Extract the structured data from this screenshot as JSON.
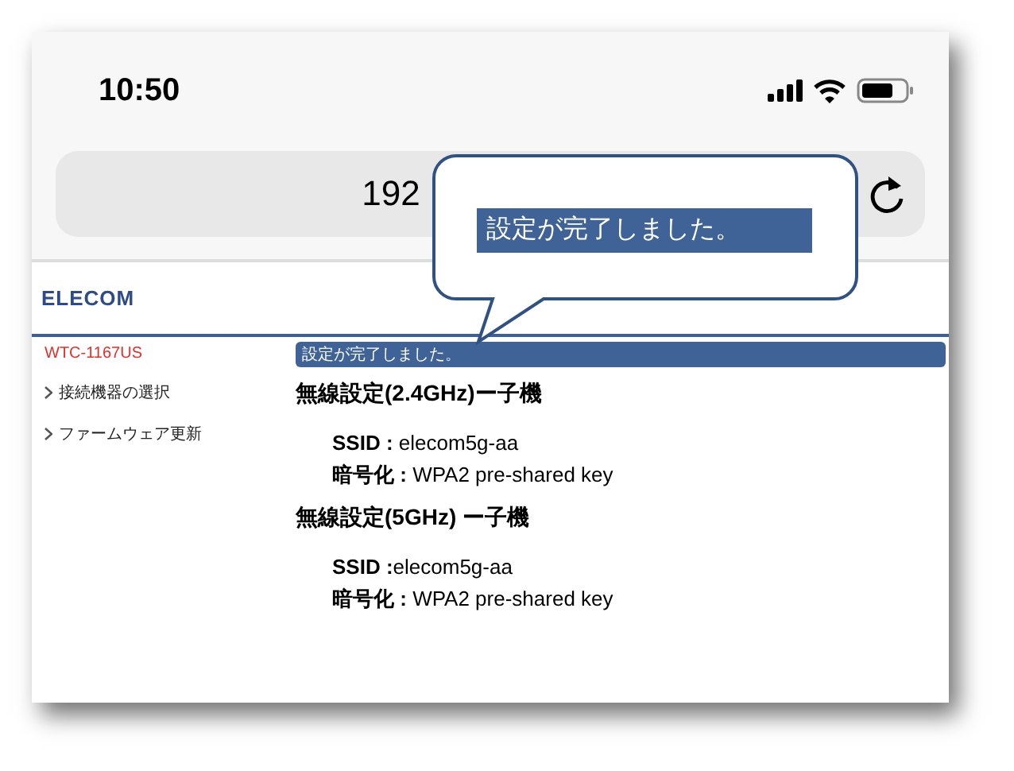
{
  "status_bar": {
    "time": "10:50"
  },
  "address_bar": {
    "url": "192"
  },
  "callout": {
    "text": "設定が完了しました。"
  },
  "header": {
    "logo": "ELECOM"
  },
  "sidebar": {
    "model": "WTC-1167US",
    "items": [
      {
        "label": "接続機器の選択"
      },
      {
        "label": "ファームウェア更新"
      }
    ]
  },
  "banner": "設定が完了しました。",
  "sections": [
    {
      "title": "無線設定(2.4GHz)ー子機",
      "lines": [
        "**SSID :** elecom5g-aa",
        "**暗号化 :** WPA2 pre-shared key"
      ]
    },
    {
      "title": "無線設定(5GHz) ー子機",
      "lines": [
        "**SSID :**elecom5g-aa",
        "**暗号化 :** WPA2 pre-shared key"
      ]
    }
  ]
}
